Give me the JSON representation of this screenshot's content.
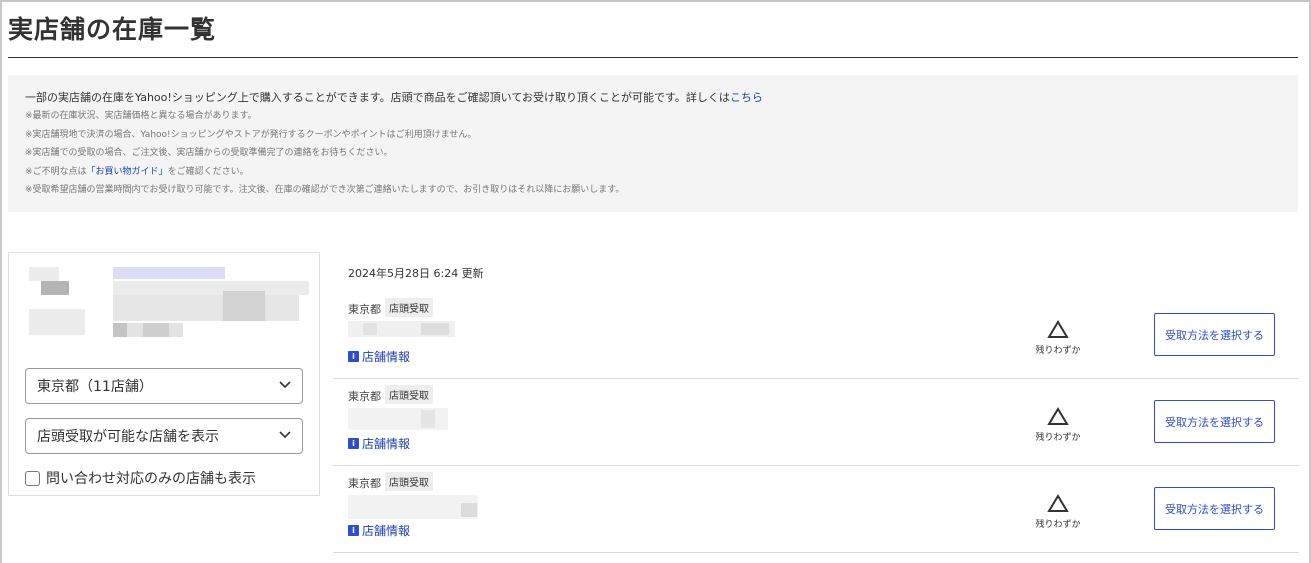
{
  "page": {
    "title": "実店舗の在庫一覧"
  },
  "notice": {
    "main_text": "一部の実店舗の在庫をYahoo!ショッピング上で購入することができます。店頭で商品をご確認頂いてお受け取り頂くことが可能です。詳しくは",
    "main_link": "こちら",
    "notes": [
      "※最新の在庫状況、実店舗価格と異なる場合があります。",
      "※実店舗現地で決済の場合、Yahoo!ショッピングやストアが発行するクーポンやポイントはご利用頂けません。",
      "※実店舗での受取の場合、ご注文後、実店舗からの受取準備完了の連絡をお待ちください。"
    ],
    "guide_prefix": "※ご不明な点は",
    "guide_link": "「お買い物ガイド」",
    "guide_suffix": "をご確認ください。",
    "last_note": "※受取希望店舗の営業時間内でお受け取り可能です。注文後、在庫の確認ができ次第ご連絡いたしますので、お引き取りはそれ以降にお願いします。"
  },
  "filters": {
    "prefecture_select": "東京都（11店舗）",
    "pickup_select": "店頭受取が可能な店舗を表示",
    "inquiry_checkbox_label": "問い合わせ対応のみの店舗も表示",
    "inquiry_checked": false
  },
  "updated_at": "2024年5月28日 6:24 更新",
  "stores": [
    {
      "prefecture": "東京都",
      "tag": "店頭受取",
      "info_link": "店舗情報",
      "stock_symbol": "△",
      "stock_label": "残りわずか",
      "button": "受取方法を選択する"
    },
    {
      "prefecture": "東京都",
      "tag": "店頭受取",
      "info_link": "店舗情報",
      "stock_symbol": "△",
      "stock_label": "残りわずか",
      "button": "受取方法を選択する"
    },
    {
      "prefecture": "東京都",
      "tag": "店頭受取",
      "info_link": "店舗情報",
      "stock_symbol": "△",
      "stock_label": "残りわずか",
      "button": "受取方法を選択する"
    }
  ],
  "colors": {
    "link": "#1f3fb5",
    "button_border": "#2f4dd0",
    "notice_bg": "#f4f4f4"
  },
  "icons": {
    "info": "info-square-icon",
    "stock": "triangle-outline-icon",
    "select": "chevron-down-icon"
  }
}
